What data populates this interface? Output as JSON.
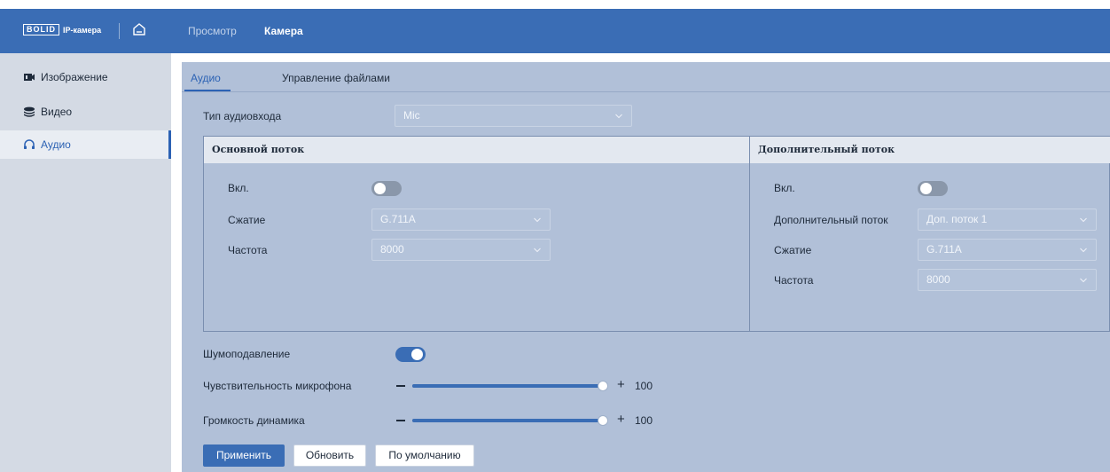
{
  "brand": {
    "logo": "BOLID",
    "product": "IP-камера"
  },
  "nav": {
    "view": "Просмотр",
    "camera": "Камера"
  },
  "sidebar": {
    "items": [
      {
        "label": "Изображение",
        "icon": "camera-icon"
      },
      {
        "label": "Видео",
        "icon": "video-layers-icon"
      },
      {
        "label": "Аудио",
        "icon": "headphones-icon",
        "active": true
      }
    ]
  },
  "tabs": {
    "audio": "Аудио",
    "files": "Управление файлами"
  },
  "audio_input": {
    "label": "Тип аудиовхода",
    "value": "Mic"
  },
  "main_stream": {
    "title": "Основной поток",
    "enable_label": "Вкл.",
    "enabled": false,
    "compression_label": "Сжатие",
    "compression_value": "G.711A",
    "frequency_label": "Частота",
    "frequency_value": "8000"
  },
  "extra_stream": {
    "title": "Дополнительный поток",
    "enable_label": "Вкл.",
    "enabled": false,
    "stream_label": "Дополнительный поток",
    "stream_value": "Доп. поток 1",
    "compression_label": "Сжатие",
    "compression_value": "G.711A",
    "frequency_label": "Частота",
    "frequency_value": "8000"
  },
  "noise_reduction": {
    "label": "Шумоподавление",
    "enabled": true
  },
  "mic_sensitivity": {
    "label": "Чувствительность микрофона",
    "value": "100",
    "percent": 100
  },
  "speaker_volume": {
    "label": "Громкость динамика",
    "value": "100",
    "percent": 100
  },
  "buttons": {
    "apply": "Применить",
    "refresh": "Обновить",
    "default": "По умолчанию"
  },
  "colors": {
    "accent": "#3a6db5",
    "topbar": "#3a6db5",
    "panel": "#b1c0d8",
    "sidebar": "#d4dae4"
  }
}
